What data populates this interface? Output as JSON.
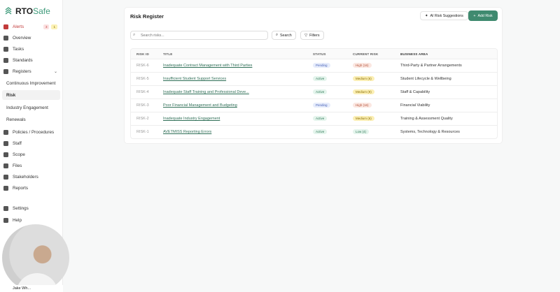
{
  "brand": {
    "prefix": "RTO",
    "suffix": "Safe"
  },
  "sidebar": {
    "items": [
      {
        "label": "Alerts",
        "badges": [
          "3",
          "1"
        ]
      },
      {
        "label": "Overview"
      },
      {
        "label": "Tasks"
      },
      {
        "label": "Standards"
      },
      {
        "label": "Registers"
      },
      {
        "label": "Continuous Improvement"
      },
      {
        "label": "Risk"
      },
      {
        "label": "Industry Engagement"
      },
      {
        "label": "Renewals"
      },
      {
        "label": "Policies / Procedures"
      },
      {
        "label": "Staff"
      },
      {
        "label": "Scope"
      },
      {
        "label": "Files"
      },
      {
        "label": "Stakeholders"
      },
      {
        "label": "Reports"
      },
      {
        "label": "Settings"
      },
      {
        "label": "Help"
      }
    ],
    "user": "Jake Wh..."
  },
  "main": {
    "title": "Risk Register",
    "ai_button": "AI Risk Suggestions",
    "add_button": "Add Risk",
    "search_placeholder": "Search risks...",
    "search_button": "Search",
    "filters_button": "Filters",
    "columns": [
      "RISK ID",
      "TITLE",
      "STATUS",
      "CURRENT RISK",
      "BUSINESS AREA"
    ],
    "rows": [
      {
        "id": "RISK-6",
        "title": "Inadequate Contract Management with Third Parties",
        "status": "Pending",
        "risk": "High (16)",
        "area": "Third-Party & Partner Arrangements"
      },
      {
        "id": "RISK-5",
        "title": "Insufficient Student Support Services",
        "status": "Active",
        "risk": "Medium (6)",
        "area": "Student Lifecycle & Wellbeing"
      },
      {
        "id": "RISK-4",
        "title": "Inadequate Staff Training and Professional Deve...",
        "status": "Active",
        "risk": "Medium (9)",
        "area": "Staff & Capability"
      },
      {
        "id": "RISK-3",
        "title": "Poor Financial Management and Budgeting",
        "status": "Pending",
        "risk": "High (16)",
        "area": "Financial Viability"
      },
      {
        "id": "RISK-2",
        "title": "Inadequate Industry Engagement",
        "status": "Active",
        "risk": "Medium (6)",
        "area": "Training & Assessment Quality"
      },
      {
        "id": "RISK-1",
        "title": "AVETMISS Reporting Errors",
        "status": "Active",
        "risk": "Low (4)",
        "area": "Systems, Technology & Resources"
      }
    ]
  },
  "colors": {
    "accent": "#3f8a6f",
    "pending": "#e6ecfb",
    "active": "#e4f4ec",
    "high": "#fbe7e1",
    "medium": "#fbefb5",
    "low": "#e4f4ec"
  }
}
